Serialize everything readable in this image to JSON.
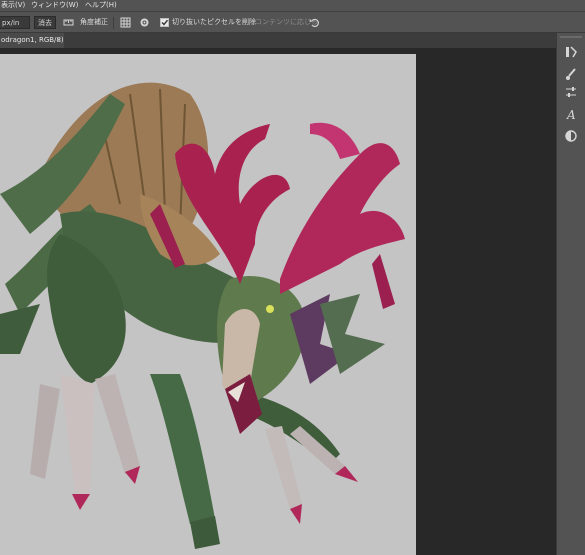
{
  "menubar": {
    "view": "表示(V)",
    "window": "ウィンドウ(W)",
    "help": "ヘルプ(H)"
  },
  "options": {
    "resolution_unit": "px/in",
    "clear_label": "消去",
    "straighten_label": "角度補正",
    "delete_cropped_label": "切り抜いたピクセルを削除",
    "delete_cropped_checked": true,
    "content_aware_label": "コンテンツに応じる"
  },
  "document": {
    "tab_title": "odragon1, RGB/8) *",
    "tab_close": "×"
  },
  "icons": [
    "grid-overlay-icon",
    "gear-icon",
    "reset-icon",
    "straighten-icon",
    "brush-settings-icon",
    "brush-icon",
    "adjust-icon",
    "character-icon",
    "adjustments-icon"
  ],
  "colors": {
    "ui_panel": "#535353",
    "workspace": "#282828",
    "document_bg": "#c4c4c4",
    "dragon_green": "#4a6a45",
    "antler_magenta": "#b0285a",
    "wing_tan": "#9b7a55"
  }
}
